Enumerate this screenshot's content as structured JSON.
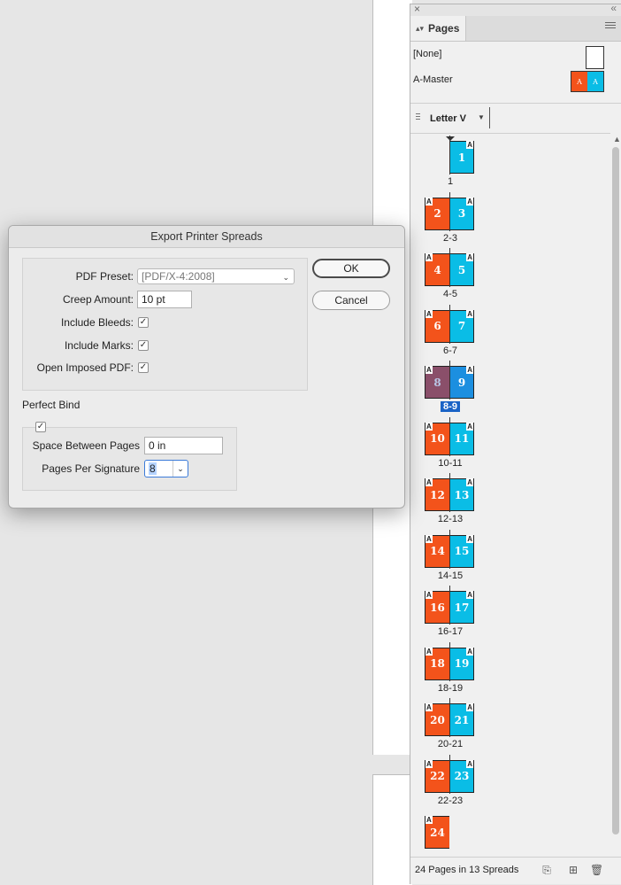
{
  "pages_panel": {
    "tab_label": "Pages",
    "masters": [
      {
        "name": "[None]"
      },
      {
        "name": "A-Master",
        "letter": "A"
      }
    ],
    "page_size": "Letter V",
    "status": "24 Pages in 13 Spreads",
    "colors": {
      "left_page": "#f3531b",
      "right_page": "#0abde6",
      "selected_left": "#8a4f6a",
      "selected_right": "#1c8fe0",
      "selection": "#1a63c6"
    },
    "master_letter": "A",
    "spreads": [
      {
        "label": "1",
        "pages": [
          "",
          "1"
        ]
      },
      {
        "label": "2-3",
        "pages": [
          "2",
          "3"
        ]
      },
      {
        "label": "4-5",
        "pages": [
          "4",
          "5"
        ]
      },
      {
        "label": "6-7",
        "pages": [
          "6",
          "7"
        ]
      },
      {
        "label": "8-9",
        "pages": [
          "8",
          "9"
        ],
        "selected": true
      },
      {
        "label": "10-11",
        "pages": [
          "10",
          "11"
        ]
      },
      {
        "label": "12-13",
        "pages": [
          "12",
          "13"
        ]
      },
      {
        "label": "14-15",
        "pages": [
          "14",
          "15"
        ]
      },
      {
        "label": "16-17",
        "pages": [
          "16",
          "17"
        ]
      },
      {
        "label": "18-19",
        "pages": [
          "18",
          "19"
        ]
      },
      {
        "label": "20-21",
        "pages": [
          "20",
          "21"
        ]
      },
      {
        "label": "22-23",
        "pages": [
          "22",
          "23"
        ]
      },
      {
        "label": "",
        "pages": [
          "24",
          ""
        ]
      }
    ]
  },
  "dialog": {
    "title": "Export Printer Spreads",
    "pdf_preset_label": "PDF Preset:",
    "pdf_preset_value": "[PDF/X-4:2008]",
    "creep_label": "Creep Amount:",
    "creep_value": "10 pt",
    "include_bleeds_label": "Include Bleeds:",
    "include_marks_label": "Include Marks:",
    "open_pdf_label": "Open Imposed PDF:",
    "ok_label": "OK",
    "cancel_label": "Cancel",
    "perfect_bind_title": "Perfect Bind",
    "space_label": "Space Between Pages",
    "space_value": "0 in",
    "signature_label": "Pages Per Signature",
    "signature_value": "8",
    "check_mark": "✓"
  }
}
